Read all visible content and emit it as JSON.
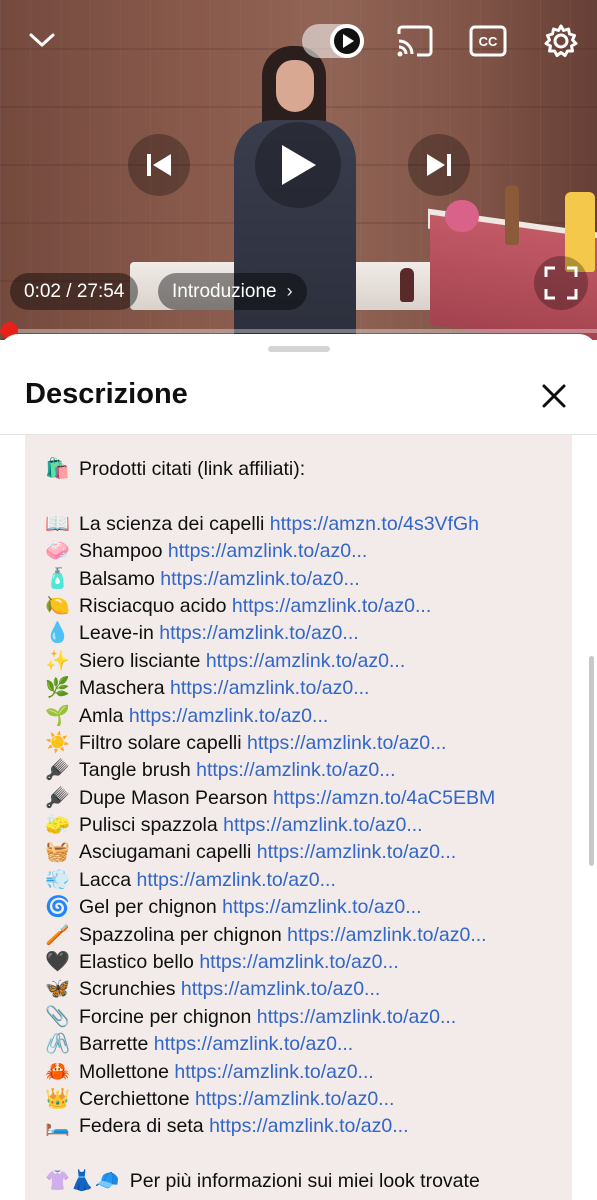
{
  "player": {
    "time": "0:02 / 27:54",
    "chapter": "Introduzione",
    "progress_fraction": 0.0012,
    "icons": [
      "chevron-down-icon",
      "autoplay-toggle-icon",
      "cast-icon",
      "cc-icon",
      "gear-icon",
      "previous-icon",
      "play-icon",
      "next-icon",
      "fullscreen-icon"
    ],
    "accent_color": "#e62117"
  },
  "sheet": {
    "title": "Descrizione",
    "close_icon": "close-icon"
  },
  "description": {
    "heading": {
      "emoji": "🛍️",
      "text": "Prodotti citati (link affiliati):"
    },
    "items": [
      {
        "emoji": "📖",
        "label": "La scienza dei capelli",
        "link": "https://amzn.to/4s3VfGh"
      },
      {
        "emoji": "🧼",
        "label": "Shampoo",
        "link": "https://amzlink.to/az0..."
      },
      {
        "emoji": "🧴",
        "label": "Balsamo",
        "link": "https://amzlink.to/az0..."
      },
      {
        "emoji": "🍋",
        "label": "Risciacquo acido",
        "link": "https://amzlink.to/az0..."
      },
      {
        "emoji": "💧",
        "label": "Leave-in",
        "link": "https://amzlink.to/az0..."
      },
      {
        "emoji": "✨",
        "label": "Siero lisciante",
        "link": "https://amzlink.to/az0..."
      },
      {
        "emoji": "🌿",
        "label": "Maschera",
        "link": "https://amzlink.to/az0..."
      },
      {
        "emoji": "🌱",
        "label": "Amla",
        "link": "https://amzlink.to/az0..."
      },
      {
        "emoji": "☀️",
        "label": "Filtro solare capelli",
        "link": "https://amzlink.to/az0..."
      },
      {
        "emoji": "🪮",
        "label": "Tangle brush",
        "link": "https://amzlink.to/az0..."
      },
      {
        "emoji": "🪮",
        "label": "Dupe Mason Pearson",
        "link": "https://amzn.to/4aC5EBM"
      },
      {
        "emoji": "🧽",
        "label": "Pulisci spazzola",
        "link": "https://amzlink.to/az0..."
      },
      {
        "emoji": "🧺",
        "label": "Asciugamani capelli",
        "link": "https://amzlink.to/az0..."
      },
      {
        "emoji": "💨",
        "label": "Lacca",
        "link": "https://amzlink.to/az0..."
      },
      {
        "emoji": "🌀",
        "label": "Gel per chignon",
        "link": "https://amzlink.to/az0..."
      },
      {
        "emoji": "🪥",
        "label": "Spazzolina per chignon",
        "link": "https://amzlink.to/az0..."
      },
      {
        "emoji": "🖤",
        "label": "Elastico bello",
        "link": "https://amzlink.to/az0..."
      },
      {
        "emoji": "🦋",
        "label": "Scrunchies",
        "link": "https://amzlink.to/az0..."
      },
      {
        "emoji": "📎",
        "label": "Forcine per chignon",
        "link": "https://amzlink.to/az0..."
      },
      {
        "emoji": "🖇️",
        "label": "Barrette",
        "link": "https://amzlink.to/az0..."
      },
      {
        "emoji": "🦀",
        "label": "Mollettone",
        "link": "https://amzlink.to/az0..."
      },
      {
        "emoji": "👑",
        "label": "Cerchiettone",
        "link": "https://amzlink.to/az0..."
      },
      {
        "emoji": "🛏️",
        "label": "Federa di seta",
        "link": "https://amzlink.to/az0..."
      }
    ],
    "footer": {
      "emoji": "👚👗🧢",
      "text": "Per più informazioni sui miei look trovate"
    }
  }
}
